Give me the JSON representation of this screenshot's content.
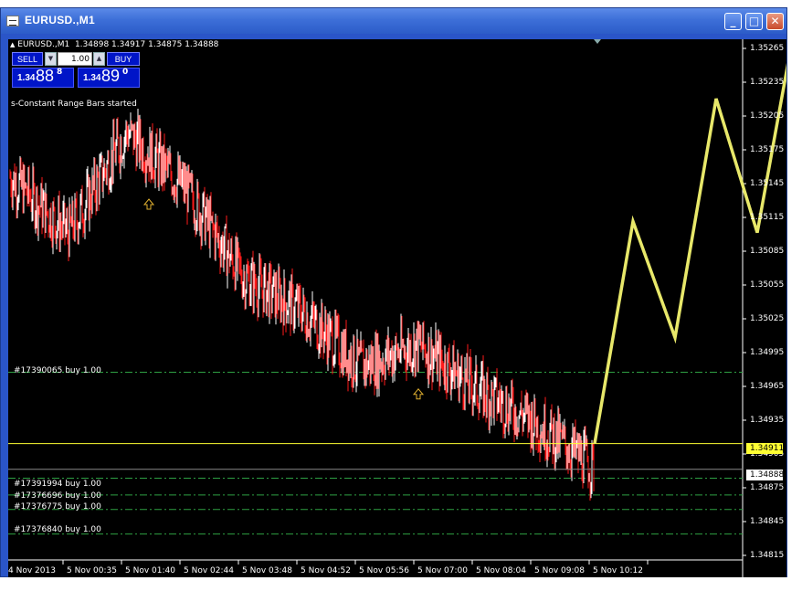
{
  "window": {
    "title": "EURUSD.,M1"
  },
  "colors": {
    "titlebar": "#3d6fd8",
    "chart_bg": "#000000",
    "bull_bar": "#ffffff",
    "bear_bar": "#ff1a1a",
    "order_line": "#2ea043",
    "bid_line": "#ffff33",
    "forecast_line": "#e8e86a",
    "panel_blue": "#0015c8"
  },
  "chart_header": {
    "ohlc_text": "EURUSD.,M1  1.34898 1.34917 1.34875 1.34888"
  },
  "trade_panel": {
    "sell_label": "SELL",
    "buy_label": "BUY",
    "lot_value": "1.00",
    "sell_quote": {
      "prefix": "1.34",
      "big": "88",
      "sup": "8"
    },
    "buy_quote": {
      "prefix": "1.34",
      "big": "89",
      "sup": "0"
    }
  },
  "status_text": "s-Constant Range Bars started",
  "orders": [
    {
      "label": "#17390065 buy 1.00",
      "price": 1.34975
    },
    {
      "label": "#17391994 buy 1.00",
      "price": 1.3488
    },
    {
      "label": "#17376696 buy 1.00",
      "price": 1.34865
    },
    {
      "label": "#17376775 buy 1.00",
      "price": 1.34852
    },
    {
      "label": "#17376840 buy 1.00",
      "price": 1.3483
    }
  ],
  "price_scale": [
    "1.35265",
    "1.35235",
    "1.35205",
    "1.35175",
    "1.35145",
    "1.35115",
    "1.35085",
    "1.35055",
    "1.35025",
    "1.34995",
    "1.34965",
    "1.34935",
    "1.34905",
    "1.34875",
    "1.34845",
    "1.34815"
  ],
  "bid_tag": "1.34911",
  "last_tag": "1.34888",
  "time_axis": [
    "4 Nov 2013",
    "5 Nov 00:35",
    "5 Nov 01:40",
    "5 Nov 02:44",
    "5 Nov 03:48",
    "5 Nov 04:52",
    "5 Nov 05:56",
    "5 Nov 07:00",
    "5 Nov 08:04",
    "5 Nov 09:08",
    "5 Nov 10:12"
  ],
  "chart_data": {
    "type": "line",
    "title": "EURUSD.,M1",
    "xlabel": "",
    "ylabel": "",
    "ylim": [
      1.348,
      1.3528
    ],
    "series": [
      {
        "name": "",
        "x": [
          "4 Nov 2013",
          "5 Nov 00:35",
          "5 Nov 01:40",
          "5 Nov 02:44",
          "5 Nov 03:48",
          "5 Nov 04:52",
          "5 Nov 05:56",
          "5 Nov 07:00",
          "5 Nov 08:04",
          "5 Nov 09:08",
          "5 Nov 10:12"
        ],
        "values": [
          1.3515,
          1.351,
          1.3519,
          1.3514,
          1.3506,
          1.3503,
          1.3498,
          1.35,
          1.3496,
          1.3493,
          1.3489
        ]
      }
    ],
    "forecast": [
      1.34911,
      1.3511,
      1.35006,
      1.3522,
      1.351,
      1.3528
    ],
    "markers": [
      1.3513,
      1.3496
    ],
    "grid": false
  }
}
